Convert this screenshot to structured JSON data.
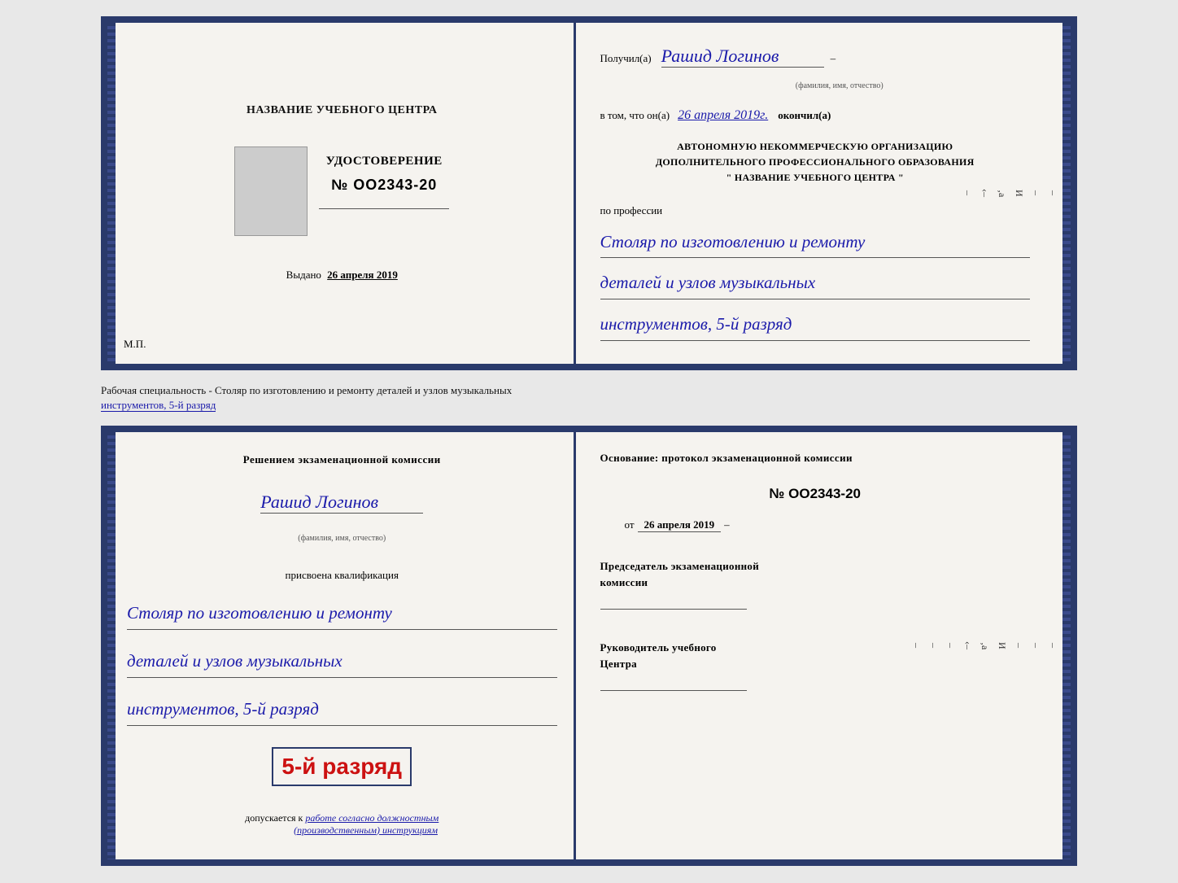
{
  "doc_top": {
    "left": {
      "center_label": "НАЗВАНИЕ УЧЕБНОГО ЦЕНТРА",
      "udostoverenie_title": "УДОСТОВЕРЕНИЕ",
      "number": "№ OO2343-20",
      "issued_label": "Выдано",
      "issued_date": "26 апреля 2019",
      "mp": "М.П."
    },
    "right": {
      "received_prefix": "Получил(а)",
      "received_name": "Рашид Логинов",
      "fio_label": "(фамилия, имя, отчество)",
      "vtom_prefix": "в том, что он(а)",
      "vtom_date": "26 апреля 2019г.",
      "vtom_suffix": "окончил(а)",
      "org_block": "АВТОНОМНУЮ НЕКОММЕРЧЕСКУЮ ОРГАНИЗАЦИЮ\nДОПОЛНИТЕЛЬНОГО ПРОФЕССИОНАЛЬНОГО ОБРАЗОВАНИЯ\n\" НАЗВАНИЕ УЧЕБНОГО ЦЕНТРА \"",
      "profession_prefix": "по профессии",
      "profession_line1": "Столяр по изготовлению и ремонту",
      "profession_line2": "деталей и узлов музыкальных",
      "profession_line3": "инструментов, 5-й разряд",
      "right_edge_labels": [
        "–",
        "–",
        "И",
        "‚а",
        "‹–",
        "–"
      ]
    }
  },
  "caption": {
    "text": "Рабочая специальность - Столяр по изготовлению и ремонту деталей и узлов музыкальных",
    "text2": "инструментов, 5-й разряд"
  },
  "doc_bottom": {
    "left": {
      "decision_text": "Решением экзаменационной комиссии",
      "name": "Рашид Логинов",
      "fio_label": "(фамилия, имя, отчество)",
      "assigned_text": "присвоена квалификация",
      "qual_line1": "Столяр по изготовлению и ремонту",
      "qual_line2": "деталей и узлов музыкальных",
      "qual_line3": "инструментов, 5-й разряд",
      "highlight_text": "5-й разряд",
      "допускается": "допускается к",
      "work_text": "работе согласно должностным",
      "instruct_text": "(производственным) инструкциям"
    },
    "right": {
      "osnov_text": "Основание: протокол экзаменационной комиссии",
      "number": "№ OO2343-20",
      "date_prefix": "от",
      "date": "26 апреля 2019",
      "chairman_label": "Председатель экзаменационной\nкомиссии",
      "head_label": "Руководитель учебного\nЦентра",
      "right_edge_labels": [
        "–",
        "–",
        "–",
        "И",
        "‚а",
        "‹–",
        "–",
        "–",
        "–"
      ]
    }
  }
}
